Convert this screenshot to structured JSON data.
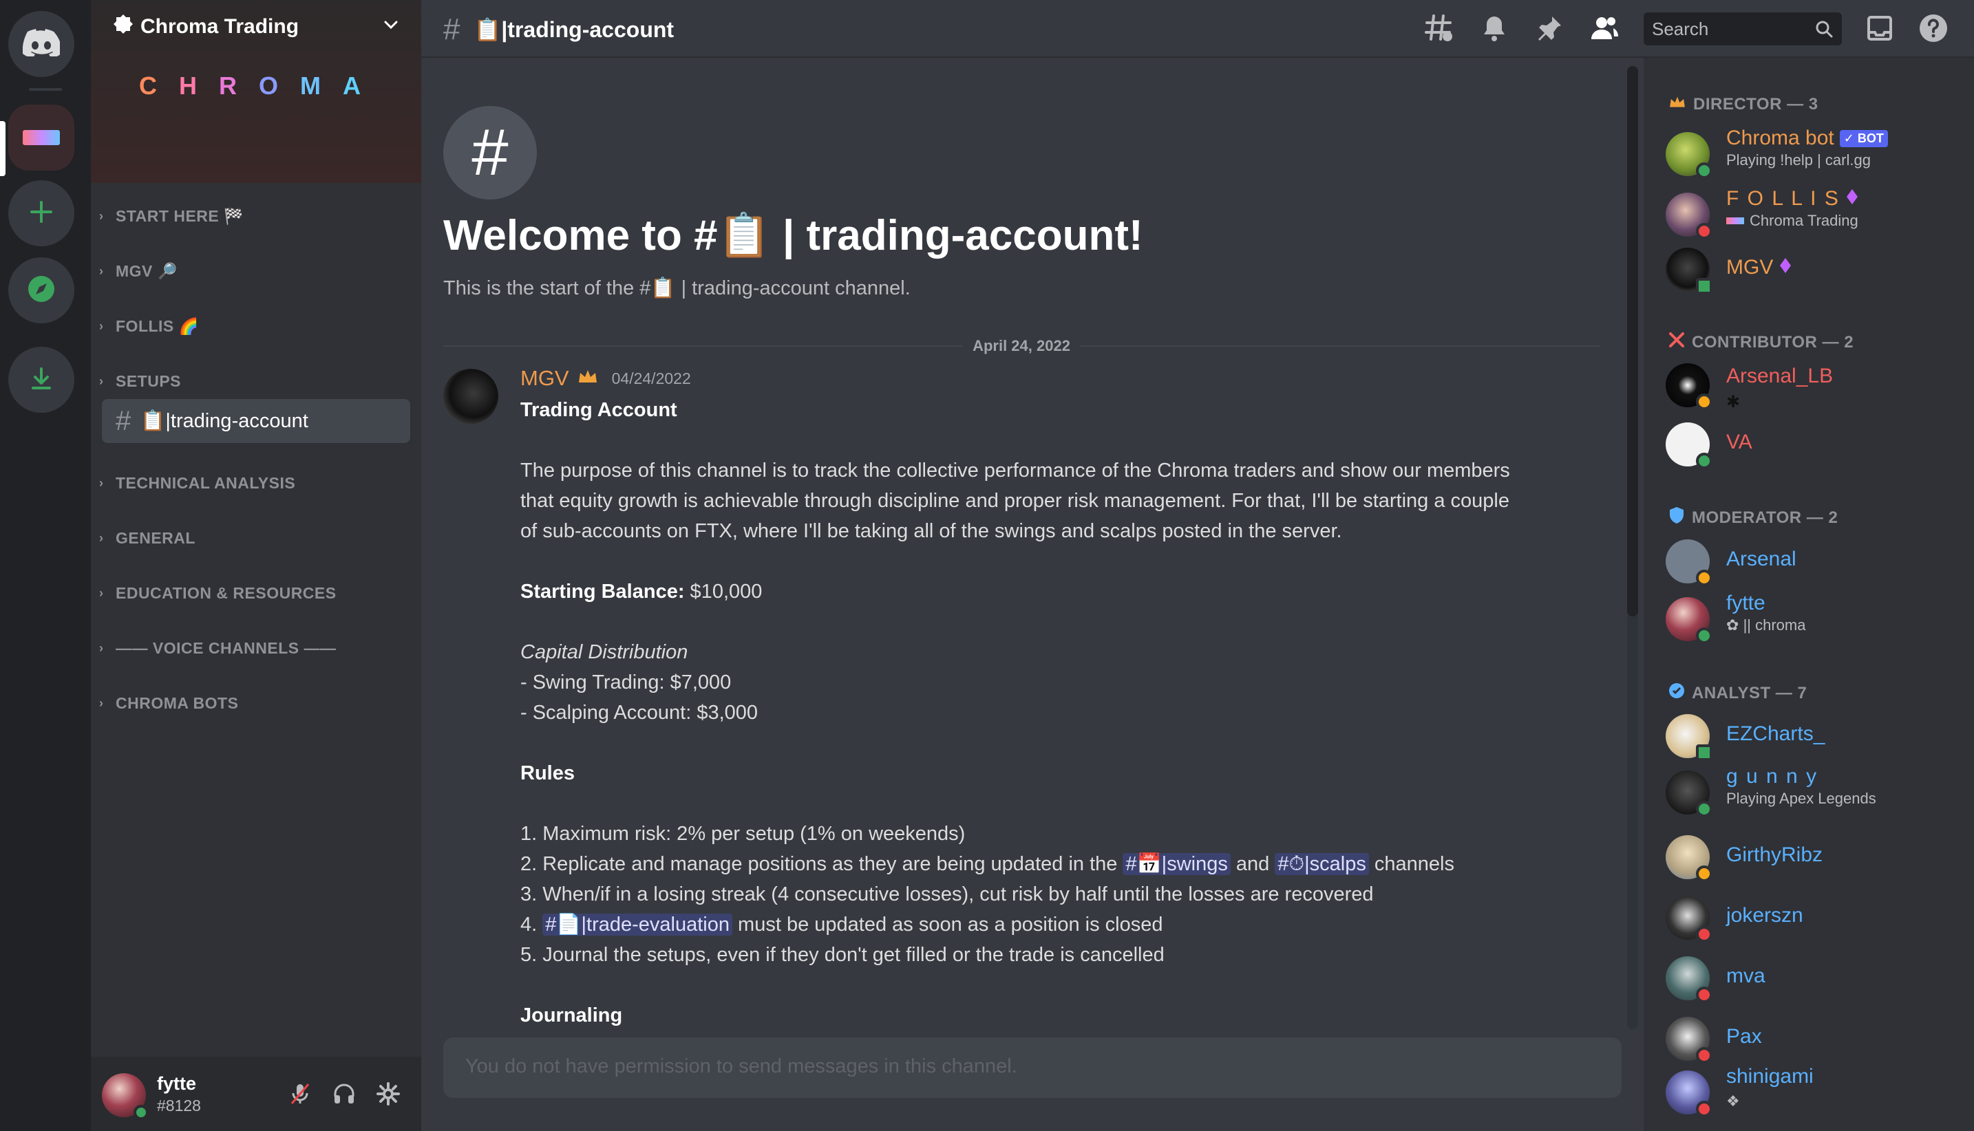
{
  "server": {
    "name": "Chroma Trading",
    "banner_letters": [
      "C",
      "H",
      "R",
      "O",
      "M",
      "A"
    ],
    "banner_colors": [
      "#ff8a5c",
      "#ff7aa8",
      "#e87ad8",
      "#8a9bff",
      "#6ec3ff",
      "#5fd0ff"
    ]
  },
  "categories": [
    {
      "label": "START HERE 🏁"
    },
    {
      "label": "MGV 🔎"
    },
    {
      "label": "FOLLIS 🌈"
    },
    {
      "label": "SETUPS"
    },
    {
      "label": "TECHNICAL ANALYSIS"
    },
    {
      "label": "GENERAL"
    },
    {
      "label": "EDUCATION & RESOURCES"
    },
    {
      "label": "—— VOICE CHANNELS ——"
    },
    {
      "label": "CHROMA BOTS"
    }
  ],
  "active_channel": {
    "hash": "#",
    "label": "📋|trading-account"
  },
  "user_panel": {
    "name": "fytte",
    "tag": "#8128"
  },
  "topbar": {
    "hash": "#",
    "title": "📋|trading-account",
    "search_placeholder": "Search"
  },
  "welcome": {
    "icon": "#",
    "title": "Welcome to #📋 | trading-account!",
    "subtitle": "This is the start of the #📋 | trading-account channel."
  },
  "date_divider": "April 24, 2022",
  "message": {
    "author": "MGV",
    "timestamp": "04/24/2022",
    "title": "Trading Account",
    "intro_lines": [
      "The purpose of this channel is to track the collective performance of the Chroma traders and show our members",
      "that equity growth is achievable through discipline and proper risk management. For that, I'll be starting a couple",
      "of sub-accounts on FTX, where I'll be taking all of the swings and scalps posted in the server."
    ],
    "starting_balance_label": "Starting Balance:",
    "starting_balance_value": " $10,000",
    "capital_label": "Capital Distribution",
    "capital_lines": [
      "- Swing Trading: $7,000",
      "- Scalping Account: $3,000"
    ],
    "rules_label": "Rules",
    "rule1": "1. Maximum risk: 2% per setup (1% on weekends)",
    "rule2_pre": "2. Replicate and manage positions as they are being updated in the ",
    "rule2_mention1": "#📅|swings",
    "rule2_mid": " and ",
    "rule2_mention2": "#⏱|scalps",
    "rule2_post": "  channels",
    "rule3": "3. When/if in a losing streak (4 consecutive losses), cut risk by half until the losses are recovered",
    "rule4_pre": "4. ",
    "rule4_mention": "#📄|trade-evaluation",
    "rule4_post": " must be updated as soon as a position is closed",
    "rule5": "5. Journal the setups, even if they don't get filled or the trade is cancelled",
    "journaling_label": "Journaling"
  },
  "input_placeholder": "You do not have permission to send messages in this channel.",
  "roles": [
    {
      "label": "DIRECTOR — 3"
    },
    {
      "label": "CONTRIBUTOR — 2"
    },
    {
      "label": "MODERATOR — 2"
    },
    {
      "label": "ANALYST — 7"
    }
  ],
  "members": [
    {
      "name": "Chroma bot",
      "badge": "✓ BOT",
      "sub": "Playing !help | carl.gg",
      "color": "#f09a4e"
    },
    {
      "name": "F O L L I S",
      "sub": "Chroma Trading",
      "color": "#f09a4e"
    },
    {
      "name": "MGV",
      "color": "#f09a4e"
    },
    {
      "name": "Arsenal_LB",
      "color": "#f25f5c"
    },
    {
      "name": "VA",
      "color": "#f25f5c"
    },
    {
      "name": "Arsenal",
      "color": "#5ab0ff"
    },
    {
      "name": "fytte",
      "sub": "|| chroma",
      "color": "#5ab0ff"
    },
    {
      "name": "EZCharts_",
      "color": "#5ab0ff"
    },
    {
      "name": "g u n n y",
      "sub": "Playing Apex Legends",
      "color": "#5ab0ff"
    },
    {
      "name": "GirthyRibz",
      "color": "#5ab0ff"
    },
    {
      "name": "jokerszn",
      "color": "#5ab0ff"
    },
    {
      "name": "mva",
      "color": "#5ab0ff"
    },
    {
      "name": "Pax",
      "color": "#5ab0ff"
    },
    {
      "name": "shinigami",
      "color": "#5ab0ff"
    }
  ]
}
